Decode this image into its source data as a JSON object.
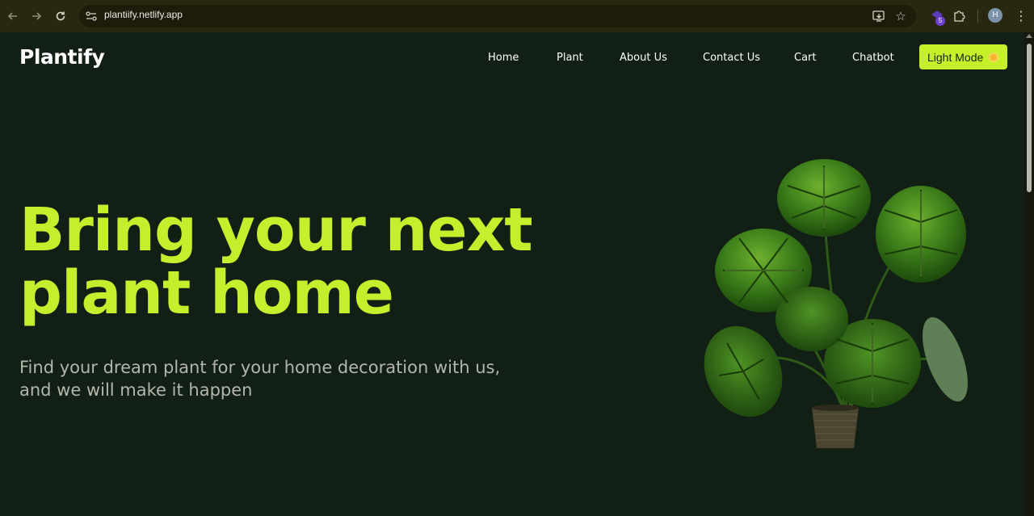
{
  "browser": {
    "url": "plantiify.netlify.app",
    "extension_badge": "5",
    "profile_initial": "H"
  },
  "header": {
    "logo": "Plantify",
    "nav": [
      "Home",
      "Plant",
      "About Us",
      "Contact Us",
      "Cart",
      "Chatbot"
    ],
    "mode_button": "Light Mode"
  },
  "hero": {
    "title_line1": "Bring your next",
    "title_line2": "plant home",
    "subtitle": "Find your dream plant for your home decoration with us, and we will make it happen"
  },
  "colors": {
    "background": "#121f14",
    "accent": "#c5ef2c",
    "text_muted": "#b4b6ad"
  }
}
